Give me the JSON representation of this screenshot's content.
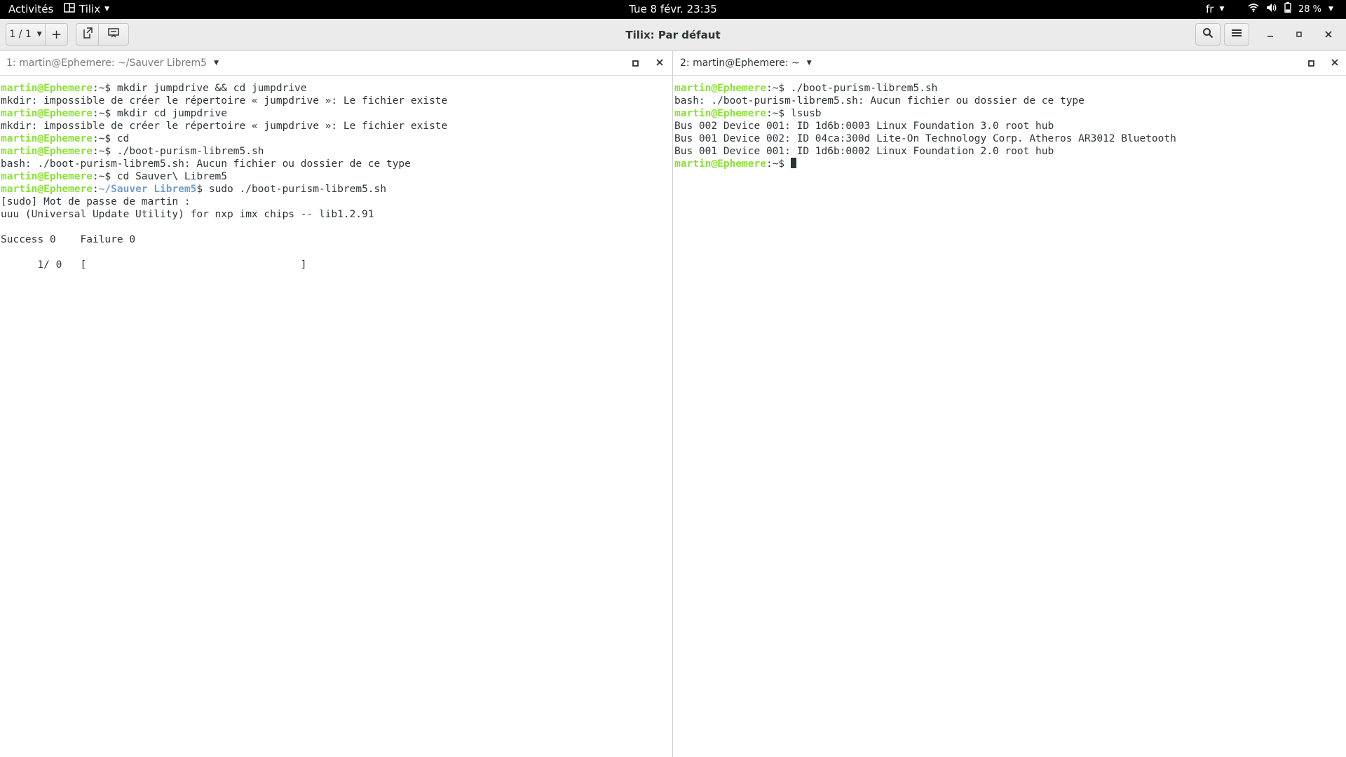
{
  "topbar": {
    "activities": "Activités",
    "app_name": "Tilix",
    "clock": "Tue 8 févr.  23:35",
    "language": "fr",
    "battery": "28 %"
  },
  "headerbar": {
    "session_indicator": "1 / 1",
    "add_label": "+",
    "title": "Tilix: Par défaut"
  },
  "panes": [
    {
      "title": "1: martin@Ephemere: ~/Sauver Librem5",
      "lines": [
        {
          "user": "martin@Ephemere",
          "path": "~",
          "cmd": " mkdir jumpdrive && cd jumpdrive"
        },
        {
          "text": "mkdir: impossible de créer le répertoire « jumpdrive »: Le fichier existe"
        },
        {
          "user": "martin@Ephemere",
          "path": "~",
          "cmd": " mkdir cd jumpdrive"
        },
        {
          "text": "mkdir: impossible de créer le répertoire « jumpdrive »: Le fichier existe"
        },
        {
          "user": "martin@Ephemere",
          "path": "~",
          "cmd": " cd"
        },
        {
          "user": "martin@Ephemere",
          "path": "~",
          "cmd": " ./boot-purism-librem5.sh"
        },
        {
          "text": "bash: ./boot-purism-librem5.sh: Aucun fichier ou dossier de ce type"
        },
        {
          "user": "martin@Ephemere",
          "path": "~",
          "cmd": " cd Sauver\\ Librem5"
        },
        {
          "user": "martin@Ephemere",
          "path": "~/Sauver Librem5",
          "cmd": " sudo ./boot-purism-librem5.sh",
          "colored_path": true
        },
        {
          "text": "[sudo] Mot de passe de martin :"
        },
        {
          "text": "uuu (Universal Update Utility) for nxp imx chips -- lib1.2.91"
        },
        {
          "text": ""
        },
        {
          "text": "Success 0    Failure 0"
        },
        {
          "text": ""
        },
        {
          "text": "      1/ 0   [                                   ]"
        }
      ]
    },
    {
      "title": "2: martin@Ephemere: ~",
      "lines": [
        {
          "user": "martin@Ephemere",
          "path": "~",
          "cmd": " ./boot-purism-librem5.sh"
        },
        {
          "text": "bash: ./boot-purism-librem5.sh: Aucun fichier ou dossier de ce type"
        },
        {
          "user": "martin@Ephemere",
          "path": "~",
          "cmd": " lsusb"
        },
        {
          "text": "Bus 002 Device 001: ID 1d6b:0003 Linux Foundation 3.0 root hub"
        },
        {
          "text": "Bus 001 Device 002: ID 04ca:300d Lite-On Technology Corp. Atheros AR3012 Bluetooth"
        },
        {
          "text": "Bus 001 Device 001: ID 1d6b:0002 Linux Foundation 2.0 root hub"
        },
        {
          "user": "martin@Ephemere",
          "path": "~",
          "cmd": " ",
          "cursor": true
        }
      ]
    }
  ],
  "colors": {
    "prompt_user": "#8ae234",
    "prompt_path": "#729fcf",
    "terminal_fg": "#2e3436",
    "terminal_bg": "#ffffff",
    "topbar_bg": "#000000",
    "headerbar_bg": "#ebebeb"
  },
  "icons": {
    "app_icon": "tilix-icon",
    "wifi": "wifi-icon",
    "volume": "volume-icon",
    "battery": "battery-icon",
    "search": "search-icon",
    "menu": "hamburger-menu-icon"
  }
}
